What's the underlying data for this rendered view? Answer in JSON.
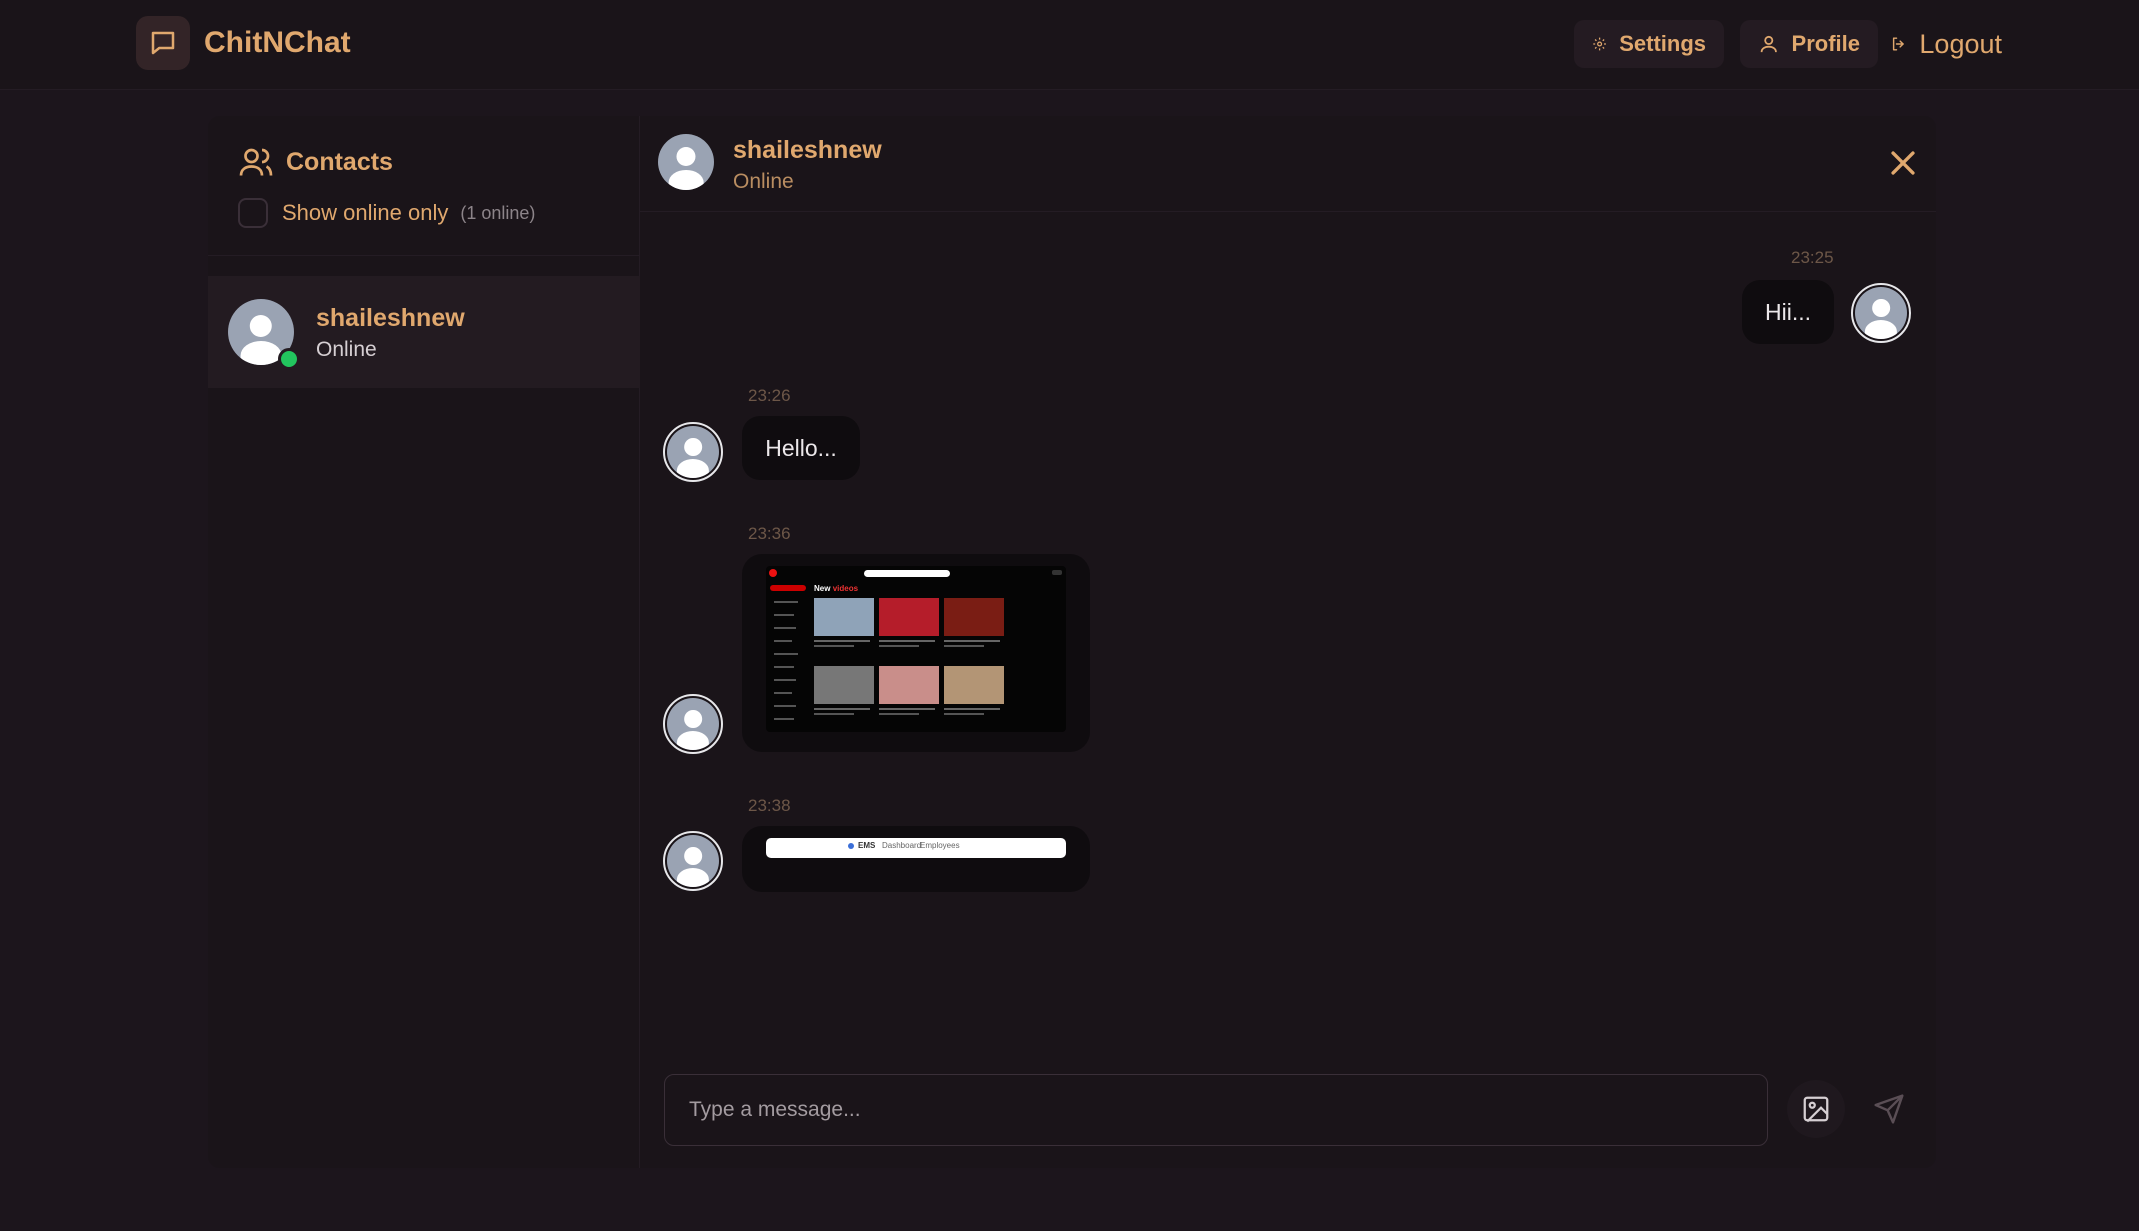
{
  "app": {
    "name": "ChitNChat"
  },
  "nav": {
    "settings": "Settings",
    "profile": "Profile",
    "logout": "Logout"
  },
  "sidebar": {
    "title": "Contacts",
    "filter_label": "Show online only",
    "online_count": "(1 online)",
    "contacts": [
      {
        "name": "shaileshnew",
        "status": "Online"
      }
    ]
  },
  "chat": {
    "contact_name": "shaileshnew",
    "contact_status": "Online",
    "messages": [
      {
        "time": "23:25",
        "text": "Hii...",
        "sender": "me"
      },
      {
        "time": "23:26",
        "text": "Hello...",
        "sender": "them"
      },
      {
        "time": "23:36",
        "type": "image",
        "sender": "them"
      },
      {
        "time": "23:38",
        "type": "image",
        "sender": "them"
      }
    ]
  },
  "thumb1": {
    "brand": "New",
    "brand_accent": "videos"
  },
  "thumb2": {
    "brand": "EMS",
    "link1": "Dashboard",
    "link2": "Employees"
  },
  "composer": {
    "placeholder": "Type a message..."
  },
  "colors": {
    "accent": "#e0a86e",
    "background": "#1c151c",
    "panel": "#1a1419",
    "online": "#22c55e"
  }
}
